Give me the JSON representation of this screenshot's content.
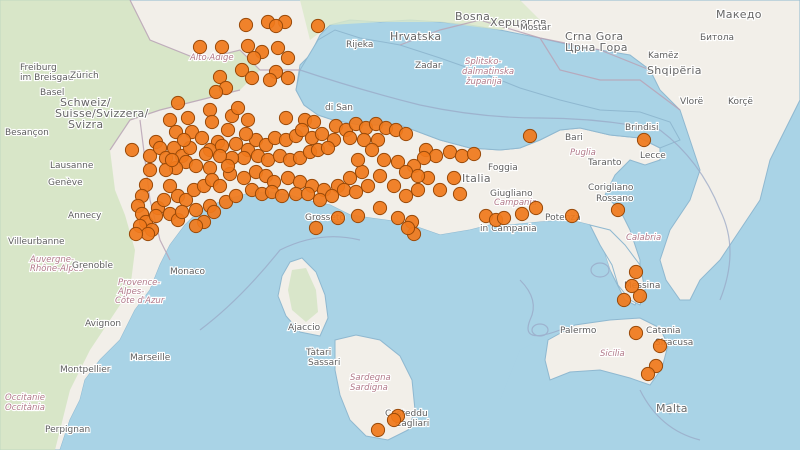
{
  "map": {
    "colors": {
      "sea": "#a9d3e6",
      "land": "#f2efe9",
      "alpine_green": "#cfe3bc",
      "land_green": "#d9e8c9",
      "border": "#b9a3b6",
      "marker_fill": "#f07a1c",
      "marker_stroke": "#9a4a09"
    },
    "labels": [
      {
        "id": "freiburg",
        "text": "Freiburg",
        "kind": "city"
      },
      {
        "id": "im-breisgau",
        "text": "im Breisgau",
        "kind": "city"
      },
      {
        "id": "zurich",
        "text": "Zürich",
        "kind": "city"
      },
      {
        "id": "basel",
        "text": "Basel",
        "kind": "city"
      },
      {
        "id": "schweiz",
        "text": "Schweiz/",
        "kind": "country"
      },
      {
        "id": "suisse",
        "text": "Suisse/Svizzera/",
        "kind": "country"
      },
      {
        "id": "svizra",
        "text": "Svizra",
        "kind": "country"
      },
      {
        "id": "besancon",
        "text": "Besançon",
        "kind": "city"
      },
      {
        "id": "lausanne",
        "text": "Lausanne",
        "kind": "city"
      },
      {
        "id": "geneve",
        "text": "Genève",
        "kind": "city"
      },
      {
        "id": "annecy",
        "text": "Annecy",
        "kind": "city"
      },
      {
        "id": "villeurbanne",
        "text": "Villeurbanne",
        "kind": "city"
      },
      {
        "id": "auvergne",
        "text": "Auvergne-",
        "kind": "region"
      },
      {
        "id": "rhone-alpes",
        "text": "Rhône-Alpes",
        "kind": "region"
      },
      {
        "id": "grenoble",
        "text": "Grenoble",
        "kind": "city"
      },
      {
        "id": "monaco",
        "text": "Monaco",
        "kind": "city"
      },
      {
        "id": "provence",
        "text": "Provence-",
        "kind": "region"
      },
      {
        "id": "alpes",
        "text": "Alpes-",
        "kind": "region"
      },
      {
        "id": "cote-azur",
        "text": "Côte d'Azur",
        "kind": "region"
      },
      {
        "id": "avignon",
        "text": "Avignon",
        "kind": "city"
      },
      {
        "id": "montpellier",
        "text": "Montpellier",
        "kind": "city"
      },
      {
        "id": "marseille",
        "text": "Marseille",
        "kind": "city"
      },
      {
        "id": "occitanie",
        "text": "Occitanie",
        "kind": "region"
      },
      {
        "id": "occitania",
        "text": "Occitània",
        "kind": "region"
      },
      {
        "id": "perpignan",
        "text": "Perpignan",
        "kind": "city"
      },
      {
        "id": "alto-adige",
        "text": "Alto Adige",
        "kind": "region"
      },
      {
        "id": "rijeka",
        "text": "Rijeka",
        "kind": "city"
      },
      {
        "id": "hrvatska",
        "text": "Hrvatska",
        "kind": "country"
      },
      {
        "id": "zadar",
        "text": "Zadar",
        "kind": "city"
      },
      {
        "id": "bosna",
        "text": "Bosna",
        "kind": "country"
      },
      {
        "id": "herceg",
        "text": "Херцегов",
        "kind": "country"
      },
      {
        "id": "mostar",
        "text": "Mostar",
        "kind": "city"
      },
      {
        "id": "crna-gora",
        "text": "Crna Gora",
        "kind": "country"
      },
      {
        "id": "crna-gora-cyr",
        "text": "Црна Гора",
        "kind": "country"
      },
      {
        "id": "shqiperia",
        "text": "Shqipëria",
        "kind": "country"
      },
      {
        "id": "kamez",
        "text": "Kamëz",
        "kind": "city"
      },
      {
        "id": "vlore",
        "text": "Vlorë",
        "kind": "city"
      },
      {
        "id": "korce",
        "text": "Korçë",
        "kind": "city"
      },
      {
        "id": "bitola",
        "text": "Битола",
        "kind": "city"
      },
      {
        "id": "makedonija",
        "text": "Македо",
        "kind": "country"
      },
      {
        "id": "split-dalm",
        "text": "Splitsko-",
        "kind": "region"
      },
      {
        "id": "split-dalm2",
        "text": "dalmatinska",
        "kind": "region"
      },
      {
        "id": "split-dalm3",
        "text": "županija",
        "kind": "region"
      },
      {
        "id": "san",
        "text": "di San",
        "kind": "city"
      },
      {
        "id": "bari",
        "text": "Bari",
        "kind": "city"
      },
      {
        "id": "brindisi",
        "text": "Brindisi",
        "kind": "city"
      },
      {
        "id": "lecce",
        "text": "Lecce",
        "kind": "city"
      },
      {
        "id": "taranto",
        "text": "Taranto",
        "kind": "city"
      },
      {
        "id": "foggia",
        "text": "Foggia",
        "kind": "city"
      },
      {
        "id": "puglia",
        "text": "Puglia",
        "kind": "region"
      },
      {
        "id": "potenza",
        "text": "Potenza",
        "kind": "city"
      },
      {
        "id": "corigliano",
        "text": "Corigliano",
        "kind": "city"
      },
      {
        "id": "rossano",
        "text": "Rossano",
        "kind": "city"
      },
      {
        "id": "calabria",
        "text": "Calabria",
        "kind": "region"
      },
      {
        "id": "campania",
        "text": "Campania",
        "kind": "region"
      },
      {
        "id": "giugliano",
        "text": "Giugliano",
        "kind": "city"
      },
      {
        "id": "in-campania",
        "text": "in Campania",
        "kind": "city"
      },
      {
        "id": "italia",
        "text": "Italia",
        "kind": "country"
      },
      {
        "id": "grosseto",
        "text": "Grosseto",
        "kind": "city"
      },
      {
        "id": "messina",
        "text": "Messina",
        "kind": "city"
      },
      {
        "id": "palermo",
        "text": "Palermo",
        "kind": "city"
      },
      {
        "id": "catania",
        "text": "Catania",
        "kind": "city"
      },
      {
        "id": "siracusa",
        "text": "Siracusa",
        "kind": "city"
      },
      {
        "id": "sicilia",
        "text": "Sicilia",
        "kind": "region"
      },
      {
        "id": "malta",
        "text": "Malta",
        "kind": "country"
      },
      {
        "id": "ajaccio",
        "text": "Ajaccio",
        "kind": "city"
      },
      {
        "id": "sassari",
        "text": "Sassari",
        "kind": "city"
      },
      {
        "id": "tattari",
        "text": "Tàtari",
        "kind": "city"
      },
      {
        "id": "sardegna",
        "text": "Sardegna",
        "kind": "region"
      },
      {
        "id": "sardigna",
        "text": "Sardigna",
        "kind": "region"
      },
      {
        "id": "cagliari",
        "text": "Cagliari",
        "kind": "city"
      },
      {
        "id": "casteddu",
        "text": "Casteddu",
        "kind": "city"
      }
    ],
    "marker_count": 210
  }
}
